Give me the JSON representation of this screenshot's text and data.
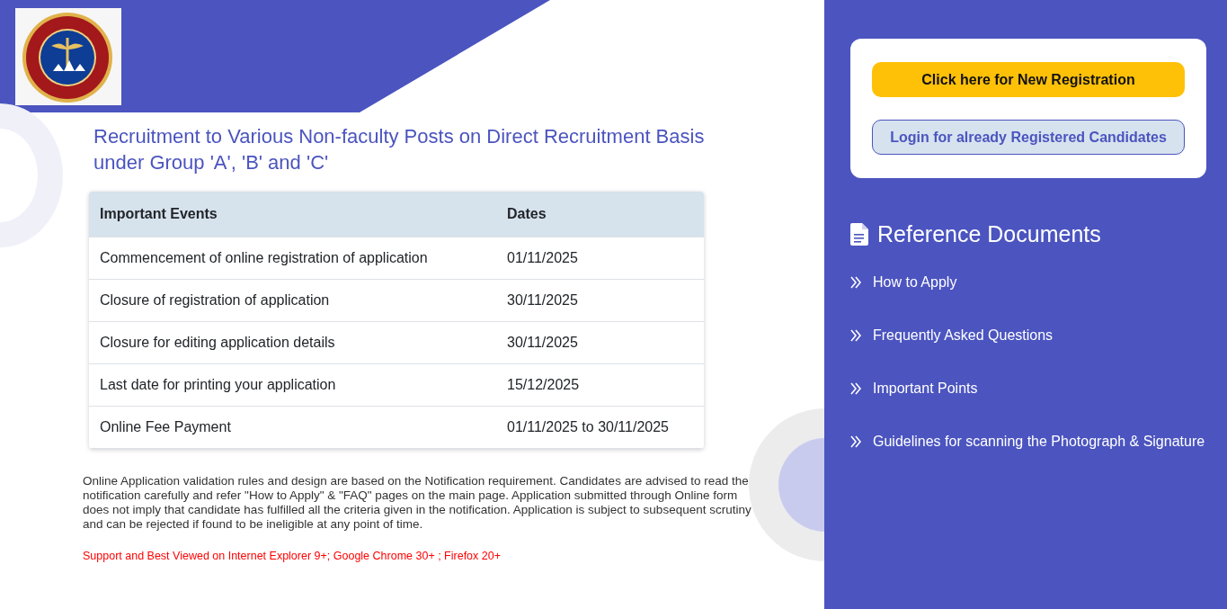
{
  "title": "Recruitment to Various Non-faculty Posts on Direct Recruitment Basis under Group 'A', 'B' and 'C'",
  "table": {
    "columns": [
      "Important Events",
      "Dates"
    ],
    "rows": [
      [
        "Commencement of online registration of application",
        "01/11/2025"
      ],
      [
        "Closure of registration of application",
        "30/11/2025"
      ],
      [
        "Closure for editing application details",
        "30/11/2025"
      ],
      [
        "Last date for printing your application",
        "15/12/2025"
      ],
      [
        "Online Fee Payment",
        "01/11/2025 to 30/11/2025"
      ]
    ]
  },
  "notice": "Online Application validation rules and design are based on the Notification requirement. Candidates are advised to read the notification carefully and refer \"How to Apply\" & \"FAQ\" pages on the main page. Application submitted through Online form does not imply that candidate has fulfilled all the criteria given in the notification. Application is subject to subsequent scrutiny and can be rejected if found to be ineligible at any point of time.",
  "browser_note": "Support and Best Viewed on Internet Explorer 9+; Google Chrome 30+ ; Firefox 20+",
  "buttons": [
    {
      "label": "Click here for New Registration",
      "kind": "primary"
    },
    {
      "label": "Login for already Registered Candidates",
      "kind": "secondary"
    }
  ],
  "reference": {
    "heading": "Reference Documents",
    "links": [
      "How to Apply",
      "Frequently Asked Questions",
      "Important Points",
      "Guidelines for scanning the Photograph & Signature"
    ]
  }
}
